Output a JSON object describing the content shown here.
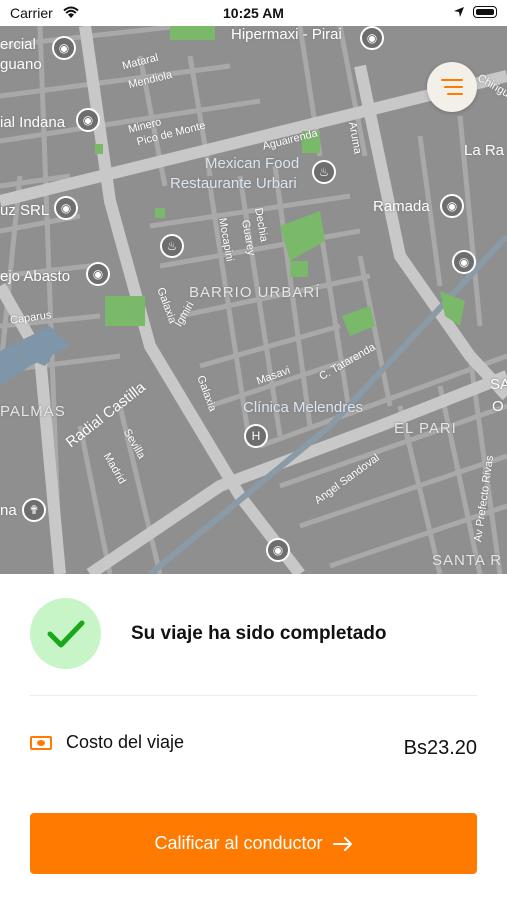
{
  "status_bar": {
    "carrier": "Carrier",
    "time": "10:25 AM"
  },
  "map": {
    "labels": [
      "Hipermaxi - Pirai",
      "ercial",
      "guano",
      "Mataral",
      "Mendiola",
      "Minero",
      "Pico de Monte",
      "ial Indana",
      "Aguairenda",
      "Aruma",
      "Chirigu",
      "La Ra",
      "Mexican Food",
      "Restaurante Urbari",
      "Ramada",
      "uz SRL",
      "Dechia",
      "Guarey",
      "Mocapini",
      "ejo Abasto",
      "BARRIO URBARÍ",
      "Caparus",
      "Galaxia",
      "Igmiri",
      "Masavi",
      "C. Tatarenda",
      "SA",
      "O",
      "PALMAS",
      "Radial Castilla",
      "Clínica Melendres",
      "EL PARI",
      "Sevilla",
      "Madrid",
      "Angel Sandoval",
      "Av Prefecto Rivas",
      "na",
      "SANTA R",
      "Galaxia"
    ],
    "colors": {
      "background": "#8f8f8f",
      "street": "#b4b4b4",
      "avenue": "#c6c6c6",
      "park": "#7ab86a",
      "water": "#7f95a8"
    }
  },
  "menu_button": {
    "icon": "menu-lines-icon",
    "color": "#ff7a00"
  },
  "trip": {
    "completed_title": "Su viaje ha sido completado",
    "cost_label": "Costo del viaje",
    "cost_value": "Bs23.20",
    "rate_button_label": "Calificar al conductor"
  },
  "colors": {
    "accent": "#ff7a00",
    "success_bg": "#c8f5c8",
    "success": "#1aa81a"
  }
}
